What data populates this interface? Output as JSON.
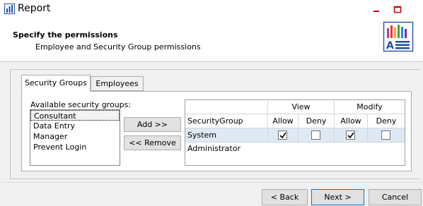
{
  "window": {
    "title": "Report",
    "icon": "report-app-icon",
    "controls": [
      "minimize-icon",
      "maximize-icon"
    ]
  },
  "header": {
    "title": "Specify the permissions",
    "subtitle": "Employee and Security Group permissions",
    "icon": "report-chart-icon"
  },
  "tabs": [
    {
      "label": "Security Groups",
      "active": true
    },
    {
      "label": "Employees",
      "active": false
    }
  ],
  "security_groups": {
    "available_label": "Available security groups:",
    "items": [
      "Consultant",
      "Data Entry",
      "Manager",
      "Prevent Login"
    ],
    "selected": "Consultant",
    "add_label": "Add >>",
    "remove_label": "<< Remove"
  },
  "permissions_grid": {
    "group_headers": [
      "View",
      "Modify"
    ],
    "column_header": "SecurityGroup",
    "sub_headers": [
      "Allow",
      "Deny",
      "Allow",
      "Deny"
    ],
    "rows": [
      {
        "group": "System Administrator",
        "view_allow": true,
        "view_deny": false,
        "modify_allow": true,
        "modify_deny": false,
        "selected": true
      }
    ]
  },
  "footer": {
    "back_label": "< Back",
    "next_label": "Next >",
    "cancel_label": "Cancel"
  },
  "colors": {
    "selection": "#dde9f5",
    "default_button_border": "#0078d7"
  }
}
